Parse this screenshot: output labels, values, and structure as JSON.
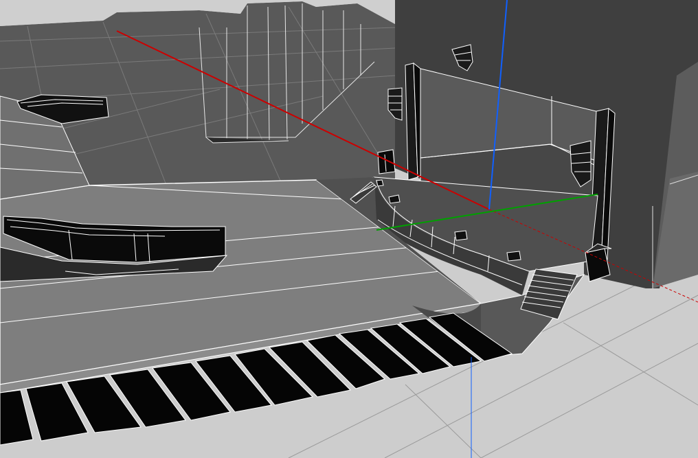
{
  "viewport": {
    "mode": "3d-perspective",
    "render_style": "hidden-line wireframe",
    "background_color": "#cdcdcd"
  },
  "axes": {
    "x_color": "#cc0000",
    "y_color": "#00a000",
    "z_color": "#1060ff"
  },
  "model": {
    "wall_color": "#3c3c3c",
    "floor_color": "#5a5a5a",
    "edge_color": "#ffffff",
    "seat_color": "#000000"
  }
}
